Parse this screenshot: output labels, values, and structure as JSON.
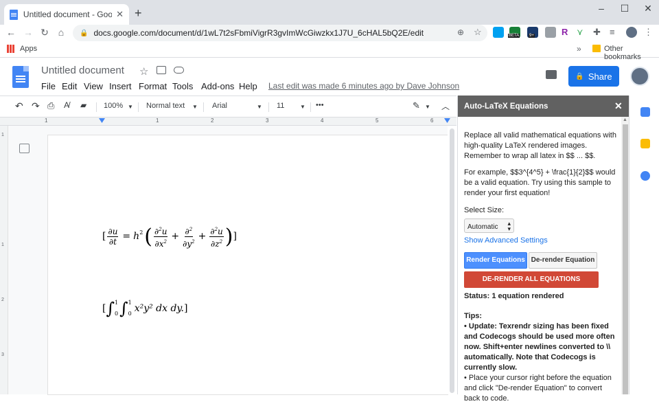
{
  "browser": {
    "tab_title": "Untitled document - Google Doc",
    "tab_close": "✕",
    "new_tab": "+",
    "url": "docs.google.com/document/d/1wL7t2sFbmiVigrR3gvImWcGiwzkx1J7U_6cHAL5bQ2E/edit",
    "bookmarks": {
      "apps": "Apps",
      "more": "»",
      "other": "Other bookmarks"
    },
    "extensions": {
      "beta_badge": "BETA",
      "count_badge": "9+",
      "r_label": "R"
    }
  },
  "docs": {
    "title": "Untitled document",
    "menus": [
      "File",
      "Edit",
      "View",
      "Insert",
      "Format",
      "Tools",
      "Add-ons",
      "Help"
    ],
    "last_edit": "Last edit was made 6 minutes ago by Dave Johnson",
    "share_label": "Share",
    "toolbar": {
      "zoom": "100%",
      "style": "Normal text",
      "font": "Arial",
      "size": "11",
      "more": "•••"
    },
    "ruler_numbers": [
      "1",
      "1",
      "2",
      "3",
      "4",
      "5",
      "6"
    ],
    "vruler_numbers": [
      "1",
      "1",
      "2",
      "3"
    ]
  },
  "equations": {
    "eq1": {
      "lb": "[",
      "partial": "∂",
      "u": "u",
      "t": "t",
      "eq": "=",
      "h": "h",
      "two": "2",
      "x2": "∂x",
      "y2": "∂y",
      "z2": "∂z",
      "plus": "+",
      "rb": "]"
    },
    "eq2": {
      "lb": "[",
      "int": "∫",
      "zero": "0",
      "one": "1",
      "body": "x²y² dx dy.",
      "rb": "]"
    }
  },
  "panel": {
    "title": "Auto-LaTeX Equations",
    "close": "✕",
    "intro": "Replace all valid mathematical equations with high-quality LaTeX rendered images. Remember to wrap all latex in $$ ... $$.",
    "example": "For example, $$3^{4^5} + \\frac{1}{2}$$ would be a valid equation. Try using this sample to render your first equation!",
    "select_label": "Select Size:",
    "size_value": "Automatic",
    "advanced": "Show Advanced Settings",
    "render_btn": "Render Equations",
    "derender_btn": "De-render Equation",
    "derender_all_btn": "DE-RENDER ALL EQUATIONS",
    "status": "Status: 1 equation rendered",
    "tips_label": "Tips:",
    "tip1": "• Update: Texrendr sizing has been fixed and Codecogs should be used more often now. Shift+enter newlines converted to \\\\ automatically. Note that Codecogs is currently slow.",
    "tip2": "• Place your cursor right before the equation and click \"De-render Equation\" to convert back to code."
  },
  "colors": {
    "accent": "#1a73e8",
    "panel_header": "#616161",
    "danger": "#d14836",
    "render": "#4d90fe"
  }
}
